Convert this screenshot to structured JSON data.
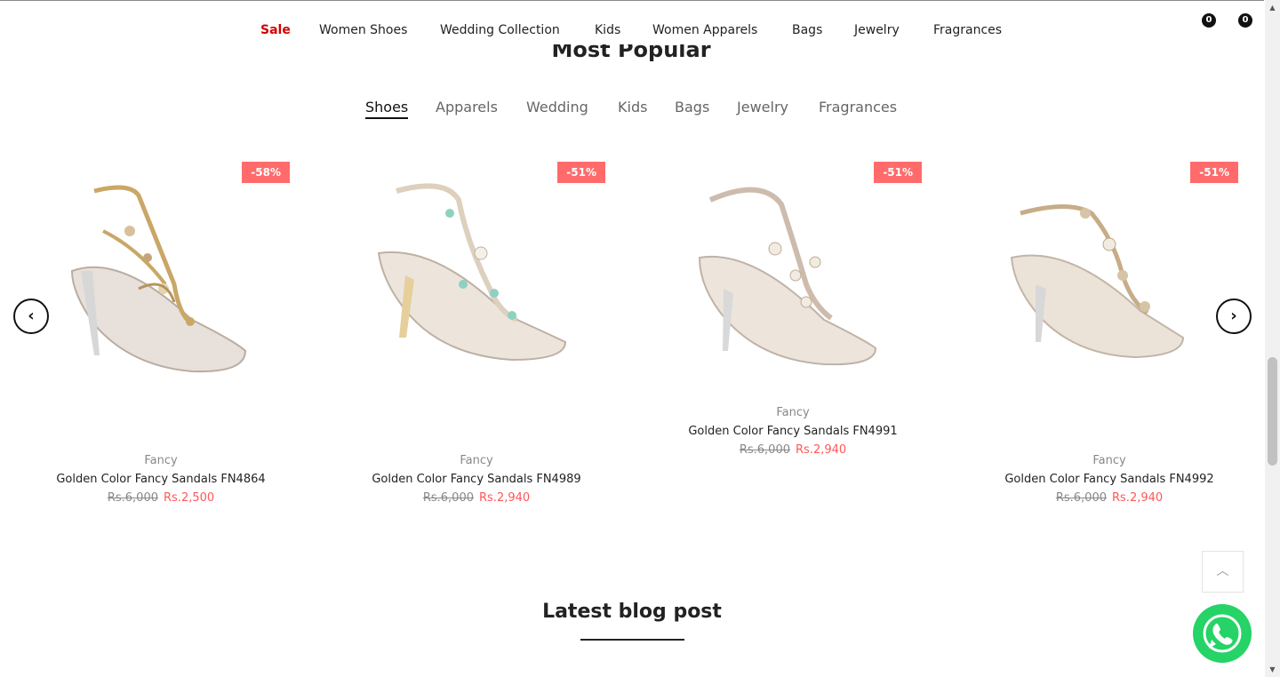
{
  "nav": {
    "items": [
      {
        "label": "Sale"
      },
      {
        "label": "Women Shoes"
      },
      {
        "label": "Wedding Collection"
      },
      {
        "label": "Kids"
      },
      {
        "label": "Women Apparels"
      },
      {
        "label": "Bags"
      },
      {
        "label": "Jewelry"
      },
      {
        "label": "Fragrances"
      }
    ],
    "wishlist_count": "0",
    "cart_count": "0"
  },
  "section": {
    "title": "Most Popular"
  },
  "tabs": [
    {
      "label": "Shoes"
    },
    {
      "label": "Apparels"
    },
    {
      "label": "Wedding"
    },
    {
      "label": "Kids"
    },
    {
      "label": "Bags"
    },
    {
      "label": "Jewelry"
    },
    {
      "label": "Fragrances"
    }
  ],
  "products": [
    {
      "discount": "-58%",
      "category": "Fancy",
      "name": "Golden Color Fancy Sandals FN4864",
      "old_price": "Rs.6,000",
      "new_price": "Rs.2,500"
    },
    {
      "discount": "-51%",
      "category": "Fancy",
      "name": "Golden Color Fancy Sandals FN4989",
      "old_price": "Rs.6,000",
      "new_price": "Rs.2,940"
    },
    {
      "discount": "-51%",
      "category": "Fancy",
      "name": "Golden Color Fancy Sandals FN4991",
      "old_price": "Rs.6,000",
      "new_price": "Rs.2,940"
    },
    {
      "discount": "-51%",
      "category": "Fancy",
      "name": "Golden Color Fancy Sandals FN4992",
      "old_price": "Rs.6,000",
      "new_price": "Rs.2,940"
    }
  ],
  "arrows": {
    "prev": "‹",
    "next": "›"
  },
  "back_to_top": "︿",
  "blog": {
    "title": "Latest blog post"
  },
  "icons": {
    "whatsapp": "whatsapp-icon",
    "prev": "chevron-left-icon",
    "next": "chevron-right-icon"
  },
  "colors": {
    "sale": "#d40000",
    "discount_badge": "#ff6b6b",
    "new_price": "#ff5757",
    "whatsapp": "#25d366"
  }
}
